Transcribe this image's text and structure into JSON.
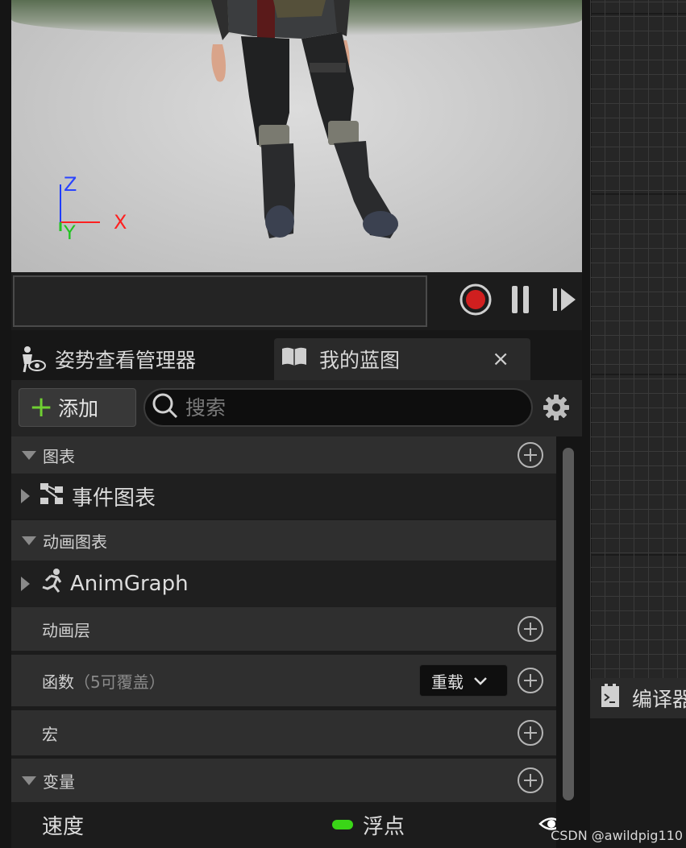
{
  "viewport": {
    "axis": {
      "z": "Z",
      "x": "X",
      "y": "Y"
    }
  },
  "playback": {
    "record_icon": "record-icon",
    "pause_icon": "pause-icon",
    "step_icon": "step-forward-icon"
  },
  "tabs": {
    "pose_watch": {
      "label": "姿势查看管理器",
      "icon": "pose-watch-icon"
    },
    "my_blueprint": {
      "label": "我的蓝图",
      "icon": "book-icon",
      "close": "×"
    }
  },
  "toolbar": {
    "add_label": "添加",
    "search_placeholder": "搜索",
    "settings_icon": "gear-icon"
  },
  "list": {
    "graphs_section": "图表",
    "event_graph": "事件图表",
    "anim_graphs_section": "动画图表",
    "anim_graph": "AnimGraph",
    "anim_layers": "动画层",
    "functions": "函数",
    "functions_count": "（5可覆盖）",
    "override_label": "重载",
    "macros": "宏",
    "variables_section": "变量",
    "variable_name": "速度",
    "variable_type": "浮点",
    "variable_type_color": "#3ad617"
  },
  "compile_tab": {
    "label": "编译器",
    "icon": "compiler-log-icon"
  },
  "watermark": "CSDN @awildpig110"
}
